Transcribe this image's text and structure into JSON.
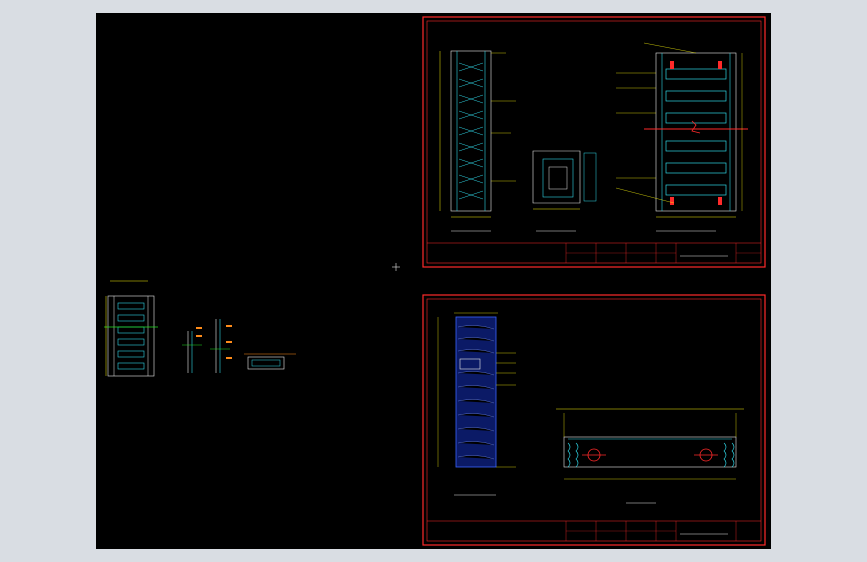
{
  "viewport": {
    "background": "#d9dde3"
  },
  "drawing": {
    "background": "#000000",
    "colors": {
      "frame": "#ff2a2a",
      "dimension": "#f7f20a",
      "profile": "#2fd6e6",
      "outline": "#e8e8e8",
      "accent_green": "#22e022",
      "accent_blue": "#3a63ff",
      "accent_orange": "#ff8c1a"
    },
    "sheets": [
      {
        "id": "sheet-1",
        "titleblock_text": ""
      },
      {
        "id": "sheet-2",
        "titleblock_text": ""
      }
    ],
    "cursor_icon": "crosshair-icon"
  }
}
